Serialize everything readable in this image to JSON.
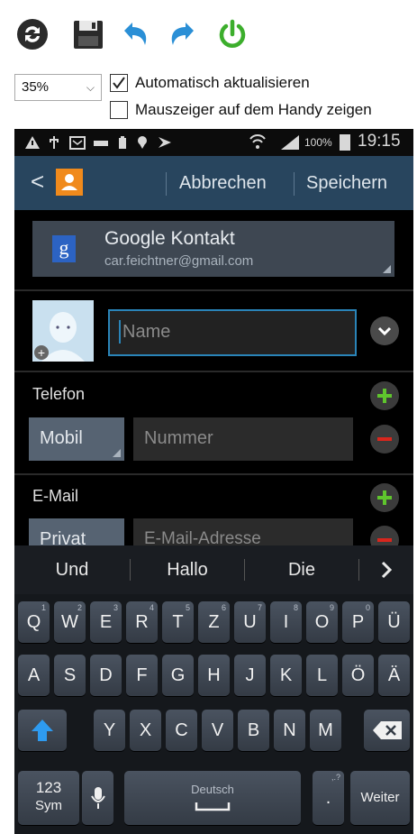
{
  "toolbar": {
    "icons": [
      "refresh-icon",
      "save-icon",
      "undo-icon",
      "redo-icon",
      "power-icon"
    ],
    "zoom_value": "35%",
    "auto_update_label": "Automatisch aktualisieren",
    "auto_update_checked": true,
    "show_pointer_label": "Mauszeiger auf dem Handy zeigen",
    "show_pointer_checked": false
  },
  "phone": {
    "status": {
      "battery_percent": "100%",
      "time": "19:15"
    },
    "actionbar": {
      "back": "<",
      "cancel": "Abbrechen",
      "save": "Speichern"
    },
    "account": {
      "title": "Google Kontakt",
      "email": "car.feichtner@gmail.com",
      "icon_letter": "g"
    },
    "name_placeholder": "Name",
    "phone_section": {
      "title": "Telefon",
      "type": "Mobil",
      "placeholder": "Nummer"
    },
    "email_section": {
      "title": "E-Mail",
      "type": "Privat",
      "placeholder": "E-Mail-Adresse"
    },
    "suggestions": [
      "Und",
      "Hallo",
      "Die"
    ],
    "keyboard": {
      "row1": [
        "Q",
        "W",
        "E",
        "R",
        "T",
        "Z",
        "U",
        "I",
        "O",
        "P",
        "Ü"
      ],
      "row1_hints": [
        "1",
        "2",
        "3",
        "4",
        "5",
        "6",
        "7",
        "8",
        "9",
        "0",
        ""
      ],
      "row2": [
        "A",
        "S",
        "D",
        "F",
        "G",
        "H",
        "J",
        "K",
        "L",
        "Ö",
        "Ä"
      ],
      "row3": [
        "Y",
        "X",
        "C",
        "V",
        "B",
        "N",
        "M"
      ],
      "sym_line1": "123",
      "sym_line2": "Sym",
      "space_label": "Deutsch",
      "dot": ".",
      "dot_hint": ",.?",
      "enter": "Weiter"
    }
  }
}
